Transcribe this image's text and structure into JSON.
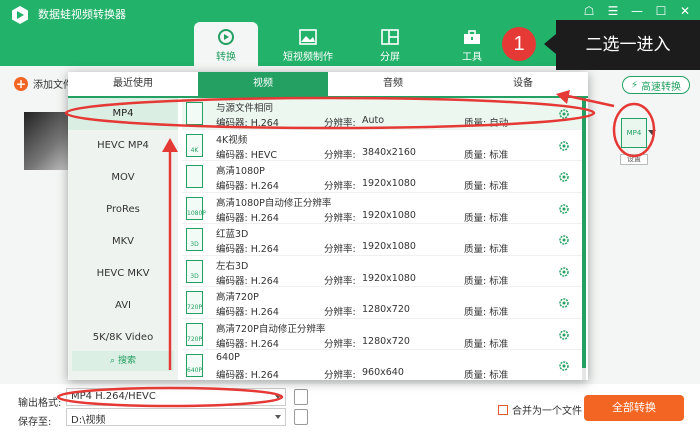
{
  "app": {
    "title": "数据蛙视频转换器"
  },
  "nav": [
    {
      "label": "转换",
      "icon": "refresh-icon",
      "active": true
    },
    {
      "label": "短视频制作",
      "icon": "image-icon",
      "active": false
    },
    {
      "label": "分屏",
      "icon": "split-screen-icon",
      "active": false
    },
    {
      "label": "工具",
      "icon": "toolbox-icon",
      "active": false
    }
  ],
  "toolbar": {
    "add_files": "添加文件",
    "fast_convert": "高速转换"
  },
  "item": {
    "format_icon_text": "MP4",
    "settings": "设置"
  },
  "panel": {
    "tabs": [
      "最近使用",
      "视频",
      "音频",
      "设备"
    ],
    "active_tab": "视频",
    "categories": [
      "MP4",
      "HEVC MP4",
      "MOV",
      "ProRes",
      "MKV",
      "HEVC MKV",
      "AVI",
      "5K/8K Video"
    ],
    "search": "搜索",
    "labels": {
      "encoder": "编码器:",
      "resolution": "分辨率:",
      "quality": "质量:"
    },
    "presets": [
      {
        "name": "与源文件相同",
        "encoder": "H.264",
        "resolution": "Auto",
        "quality": "自动",
        "tag": ""
      },
      {
        "name": "4K视频",
        "encoder": "HEVC",
        "resolution": "3840x2160",
        "quality": "标准",
        "tag": "4K"
      },
      {
        "name": "高清1080P",
        "encoder": "H.264",
        "resolution": "1920x1080",
        "quality": "标准",
        "tag": ""
      },
      {
        "name": "高清1080P自动修正分辨率",
        "encoder": "H.264",
        "resolution": "1920x1080",
        "quality": "标准",
        "tag": "1080P"
      },
      {
        "name": "红蓝3D",
        "encoder": "H.264",
        "resolution": "1920x1080",
        "quality": "标准",
        "tag": "3D"
      },
      {
        "name": "左右3D",
        "encoder": "H.264",
        "resolution": "1920x1080",
        "quality": "标准",
        "tag": "3D"
      },
      {
        "name": "高清720P",
        "encoder": "H.264",
        "resolution": "1280x720",
        "quality": "标准",
        "tag": "720P"
      },
      {
        "name": "高清720P自动修正分辨率",
        "encoder": "H.264",
        "resolution": "1280x720",
        "quality": "标准",
        "tag": "720P"
      },
      {
        "name": "640P",
        "encoder": "H.264",
        "resolution": "960x640",
        "quality": "标准",
        "tag": "640P"
      }
    ]
  },
  "bottom": {
    "output_label": "输出格式:",
    "output_value": "MP4 H.264/HEVC",
    "save_label": "保存至:",
    "save_value": "D:\\视频",
    "merge_label": "合并为一个文件",
    "convert_all": "全部转换"
  },
  "annotation": {
    "badge": "1",
    "callout": "二选一进入"
  },
  "colors": {
    "brand_green": "#23b26a",
    "accent_orange": "#f26522",
    "annotation_red": "#e53935"
  }
}
